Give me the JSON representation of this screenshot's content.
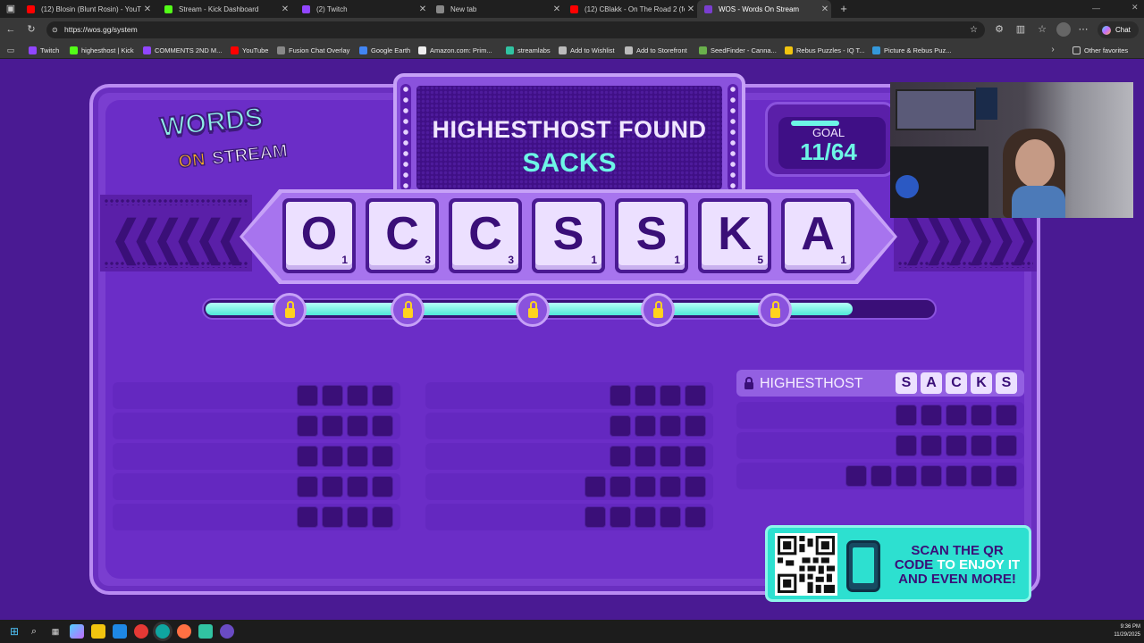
{
  "browser": {
    "tabs": [
      {
        "title": "(12) Blosin (Blunt Rosin) - YouTube",
        "color": "#ff0000",
        "active": false
      },
      {
        "title": "Stream - Kick Dashboard",
        "color": "#53fc18",
        "active": false
      },
      {
        "title": "(2) Twitch",
        "color": "#9146ff",
        "active": false
      },
      {
        "title": "New tab",
        "color": "#888888",
        "active": false
      },
      {
        "title": "(12) CBlakk - On The Road 2 (feat",
        "color": "#ff0000",
        "active": false
      },
      {
        "title": "WOS - Words On Stream",
        "color": "#7a3ed0",
        "active": true
      }
    ],
    "new_tab_label": "+",
    "close_label": "✕",
    "url": "https://wos.gg/system",
    "chat_label": "Chat",
    "bookmarks": [
      {
        "label": "Twitch",
        "color": "#9146ff"
      },
      {
        "label": "highesthost | Kick",
        "color": "#53fc18"
      },
      {
        "label": "COMMENTS 2ND M...",
        "color": "#9146ff"
      },
      {
        "label": "YouTube",
        "color": "#ff0000"
      },
      {
        "label": "Fusion Chat Overlay",
        "color": "#888888"
      },
      {
        "label": "Google Earth",
        "color": "#4285f4"
      },
      {
        "label": "Amazon.com: Prim...",
        "color": "#eeeeee"
      },
      {
        "label": "streamlabs",
        "color": "#31c3a2"
      },
      {
        "label": "Add to Wishlist",
        "color": "#bbbbbb"
      },
      {
        "label": "Add to Storefront",
        "color": "#bbbbbb"
      },
      {
        "label": "SeedFinder - Canna...",
        "color": "#6ab04c"
      },
      {
        "label": "Rebus Puzzles - IQ T...",
        "color": "#f1c40f"
      },
      {
        "label": "Picture & Rebus Puz...",
        "color": "#3498db"
      }
    ],
    "other_favorites": "Other favorites"
  },
  "game": {
    "logo_top": "WORDS",
    "logo_on": "ON",
    "logo_bottom": "STREAM",
    "found_title": "HIGHESTHOST FOUND",
    "found_word": "SACKS",
    "goal_label": "GOAL",
    "goal_value": "11/64",
    "goal_fraction": 0.171875,
    "tiles": [
      {
        "letter": "O",
        "points": "1"
      },
      {
        "letter": "C",
        "points": "3"
      },
      {
        "letter": "C",
        "points": "3"
      },
      {
        "letter": "S",
        "points": "1"
      },
      {
        "letter": "S",
        "points": "1"
      },
      {
        "letter": "K",
        "points": "5"
      },
      {
        "letter": "A",
        "points": "1"
      }
    ],
    "level_progress": 0.89,
    "locks_count": 5,
    "found_row": {
      "player": "HIGHESTHOST",
      "letters": [
        "S",
        "A",
        "C",
        "K",
        "S"
      ]
    },
    "column1_slots": [
      4,
      4,
      4,
      4,
      4
    ],
    "column2_slots": [
      4,
      4,
      4,
      5,
      5
    ],
    "column3_slots": [
      5,
      5,
      7
    ],
    "qr_text_a": "SCAN THE QR",
    "qr_text_b": "CODE",
    "qr_text_c": "TO ENJOY IT",
    "qr_text_d": "AND EVEN MORE!",
    "accent_cyan": "#6df6e6",
    "accent_purple": "#7a3ed0"
  },
  "taskbar": {
    "time": "9:36 PM",
    "date": "11/29/2025"
  }
}
